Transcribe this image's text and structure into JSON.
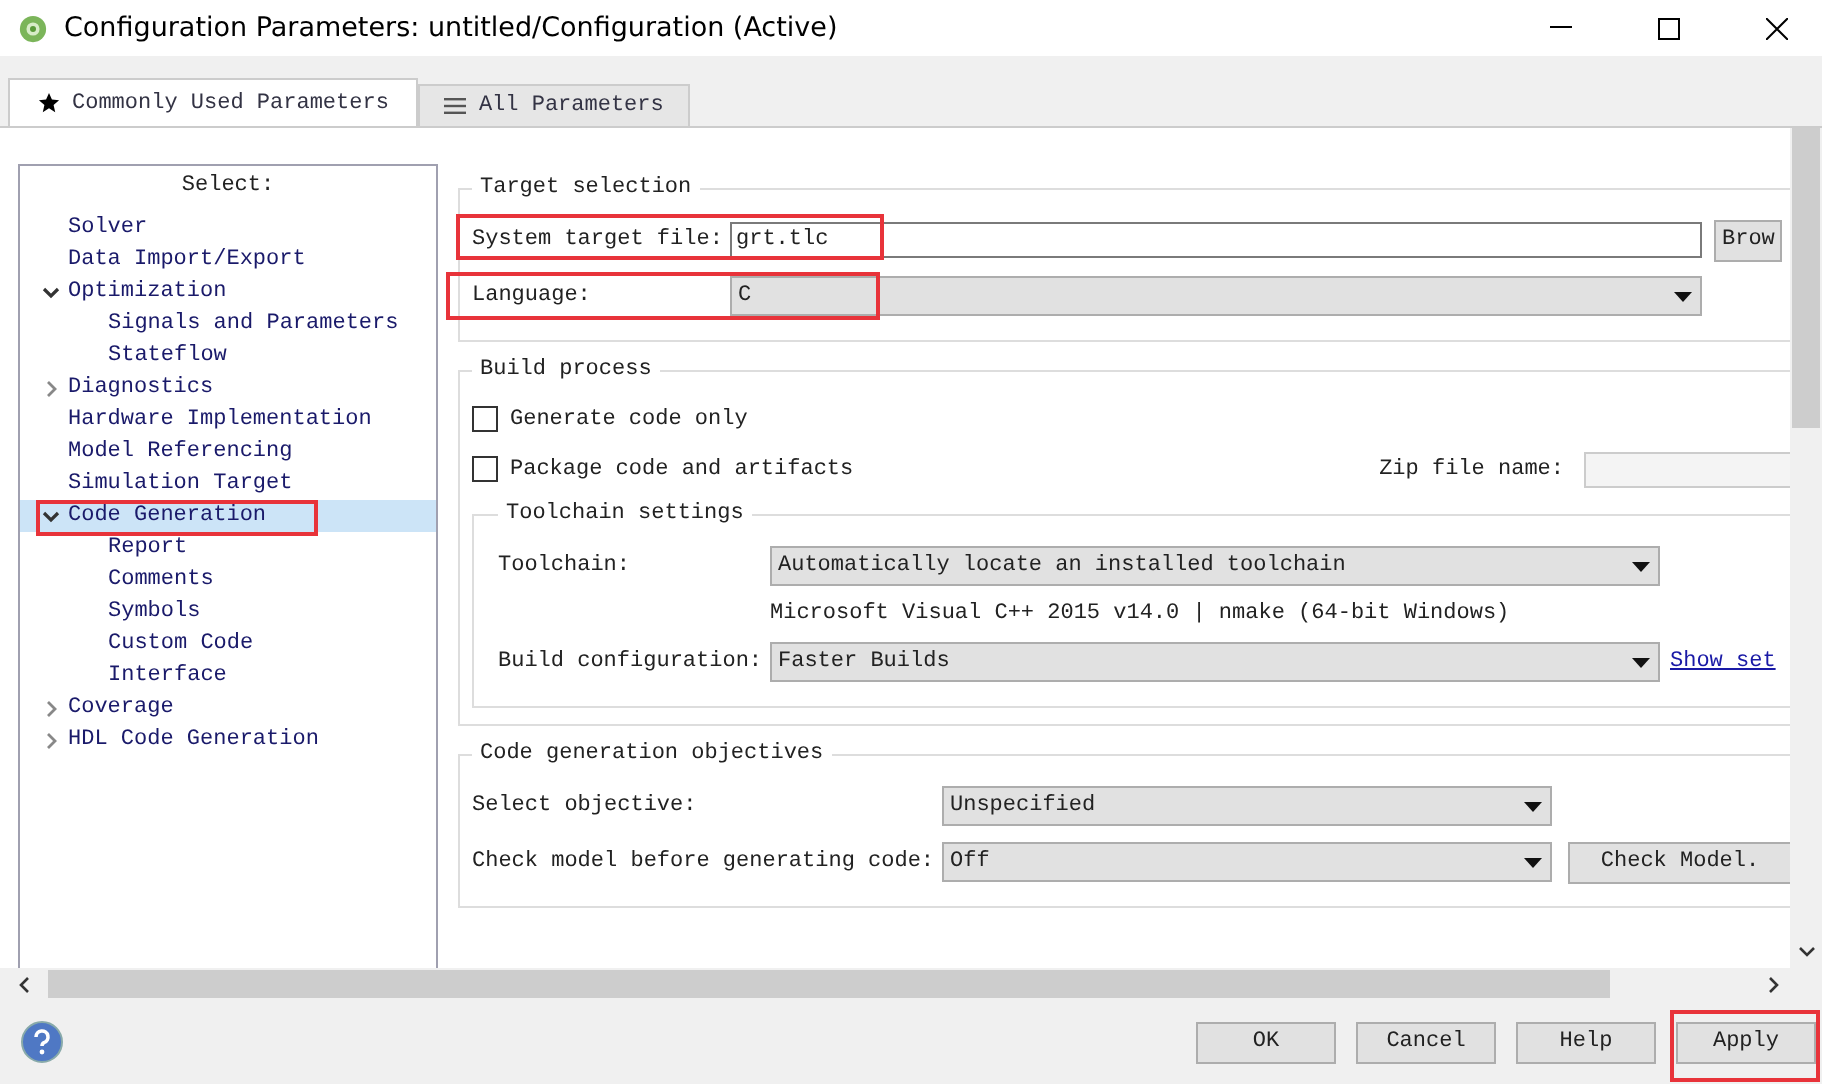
{
  "window": {
    "title": "Configuration Parameters: untitled/Configuration (Active)"
  },
  "tabs": [
    {
      "label": "Commonly Used Parameters",
      "selected": true
    },
    {
      "label": "All Parameters",
      "selected": false
    }
  ],
  "tree": {
    "title": "Select:",
    "items": [
      {
        "label": "Solver",
        "selected": false
      },
      {
        "label": "Data Import/Export",
        "selected": false
      },
      {
        "label": "Optimization",
        "selected": false,
        "expanded": true,
        "children": [
          {
            "label": "Signals and Parameters",
            "selected": false
          },
          {
            "label": "Stateflow",
            "selected": false
          }
        ]
      },
      {
        "label": "Diagnostics",
        "selected": false,
        "expanded": false
      },
      {
        "label": "Hardware Implementation",
        "selected": false
      },
      {
        "label": "Model Referencing",
        "selected": false
      },
      {
        "label": "Simulation Target",
        "selected": false
      },
      {
        "label": "Code Generation",
        "selected": true,
        "expanded": true,
        "children": [
          {
            "label": "Report",
            "selected": false
          },
          {
            "label": "Comments",
            "selected": false
          },
          {
            "label": "Symbols",
            "selected": false
          },
          {
            "label": "Custom Code",
            "selected": false
          },
          {
            "label": "Interface",
            "selected": false
          }
        ]
      },
      {
        "label": "Coverage",
        "selected": false,
        "expanded": false
      },
      {
        "label": "HDL Code Generation",
        "selected": false,
        "expanded": false
      }
    ]
  },
  "target_selection": {
    "title": "Target selection",
    "system_target_file": {
      "label": "System target file:",
      "value": "grt.tlc"
    },
    "browse_button": "Brow",
    "language": {
      "label": "Language:",
      "value": "C"
    }
  },
  "build_process": {
    "title": "Build process",
    "checkboxes": [
      {
        "label": "Generate code only",
        "checked": false
      },
      {
        "label": "Package code and artifacts",
        "checked": false
      }
    ],
    "zip_file_name": {
      "label": "Zip file name:"
    },
    "toolchain_settings": {
      "title": "Toolchain settings",
      "toolchain": {
        "label": "Toolchain:",
        "value": "Automatically locate an installed toolchain"
      },
      "toolchain_info": "Microsoft Visual C++ 2015 v14.0 | nmake (64-bit Windows)",
      "build_configuration": {
        "label": "Build configuration:",
        "value": "Faster Builds"
      },
      "link": "Show set"
    }
  },
  "objectives": {
    "title": "Code generation objectives",
    "select_objective": {
      "label": "Select objective:",
      "value": "Unspecified"
    },
    "check_model": {
      "label": "Check model before generating code:",
      "value": "Off"
    },
    "check_button": "Check Model."
  },
  "buttons": [
    "OK",
    "Cancel",
    "Help",
    "Apply"
  ]
}
